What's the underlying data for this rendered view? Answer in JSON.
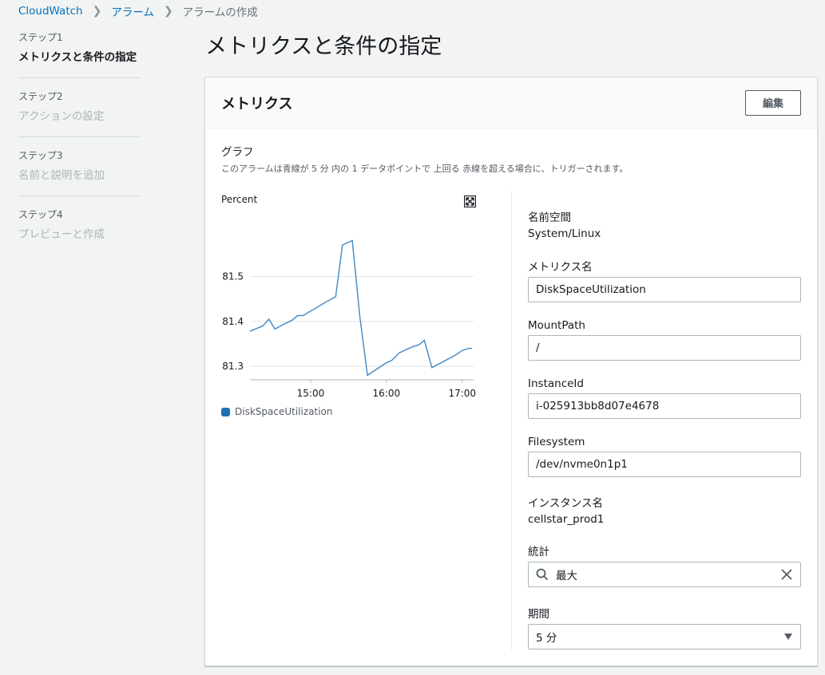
{
  "breadcrumb": {
    "items": [
      "CloudWatch",
      "アラーム",
      "アラームの作成"
    ]
  },
  "steps": [
    {
      "num": "ステップ1",
      "title": "メトリクスと条件の指定",
      "active": true
    },
    {
      "num": "ステップ2",
      "title": "アクションの設定",
      "active": false
    },
    {
      "num": "ステップ3",
      "title": "名前と説明を追加",
      "active": false
    },
    {
      "num": "ステップ4",
      "title": "プレビューと作成",
      "active": false
    }
  ],
  "page_title": "メトリクスと条件の指定",
  "panel": {
    "title": "メトリクス",
    "edit_label": "編集"
  },
  "graph": {
    "title": "グラフ",
    "description": "このアラームは青線が 5 分 内の 1 データポイントで 上回る 赤線を超える場合に、トリガーされます。",
    "expand_icon": "expand-icon"
  },
  "chart_data": {
    "type": "line",
    "ylabel": "Percent",
    "ylim": [
      81.27,
      81.62
    ],
    "yticks": [
      81.3,
      81.4,
      81.5
    ],
    "xticks": [
      {
        "label": "15:00",
        "x": 15.0
      },
      {
        "label": "16:00",
        "x": 16.0
      },
      {
        "label": "17:00",
        "x": 17.0
      }
    ],
    "xlim": [
      14.2,
      17.15
    ],
    "color": "#4a8ec9",
    "series": [
      {
        "name": "DiskSpaceUtilization",
        "points": [
          [
            14.2,
            81.378
          ],
          [
            14.37,
            81.39
          ],
          [
            14.45,
            81.405
          ],
          [
            14.53,
            81.383
          ],
          [
            14.65,
            81.394
          ],
          [
            14.75,
            81.402
          ],
          [
            14.83,
            81.413
          ],
          [
            14.9,
            81.413
          ],
          [
            15.05,
            81.428
          ],
          [
            15.2,
            81.443
          ],
          [
            15.33,
            81.455
          ],
          [
            15.42,
            81.57
          ],
          [
            15.55,
            81.58
          ],
          [
            15.65,
            81.41
          ],
          [
            15.75,
            81.28
          ],
          [
            16.0,
            81.308
          ],
          [
            16.07,
            81.313
          ],
          [
            16.17,
            81.33
          ],
          [
            16.27,
            81.338
          ],
          [
            16.35,
            81.344
          ],
          [
            16.43,
            81.348
          ],
          [
            16.5,
            81.358
          ],
          [
            16.6,
            81.297
          ],
          [
            16.7,
            81.306
          ],
          [
            16.8,
            81.315
          ],
          [
            16.9,
            81.324
          ],
          [
            17.0,
            81.335
          ],
          [
            17.08,
            81.34
          ],
          [
            17.13,
            81.34
          ]
        ]
      }
    ]
  },
  "details": {
    "namespace_label": "名前空間",
    "namespace_value": "System/Linux",
    "metric_name_label": "メトリクス名",
    "metric_name_value": "DiskSpaceUtilization",
    "mountpath_label": "MountPath",
    "mountpath_value": "/",
    "instanceid_label": "InstanceId",
    "instanceid_value": "i-025913bb8d07e4678",
    "filesystem_label": "Filesystem",
    "filesystem_value": "/dev/nvme0n1p1",
    "instance_name_label": "インスタンス名",
    "instance_name_value": "cellstar_prod1",
    "statistic_label": "統計",
    "statistic_value": "最大",
    "period_label": "期間",
    "period_value": "5 分"
  },
  "colors": {
    "link": "#0073bb",
    "series": "#4a8ec9",
    "legend_swatch": "#1f6fb4"
  }
}
